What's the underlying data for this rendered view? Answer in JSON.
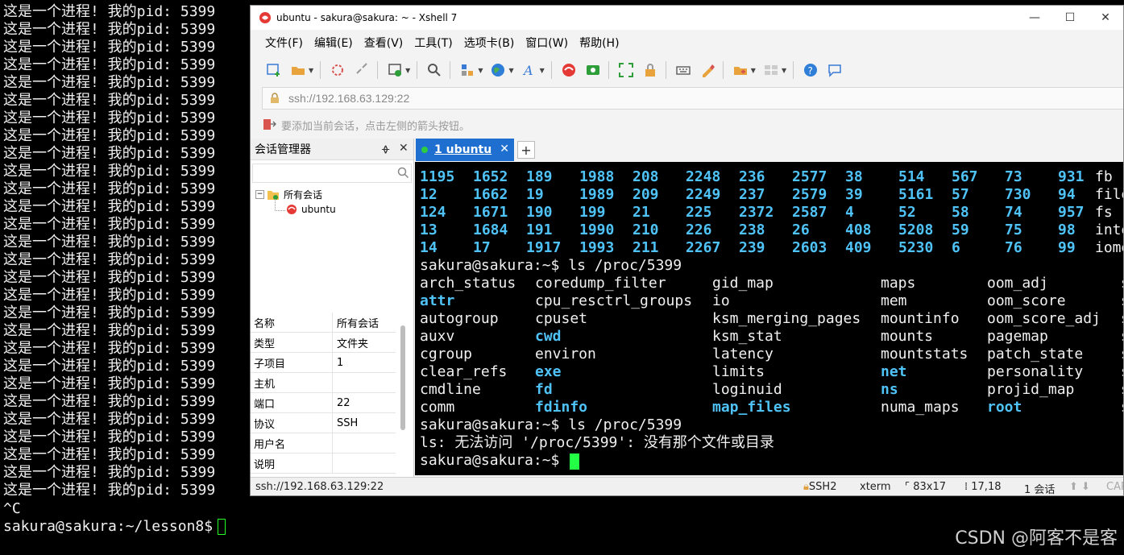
{
  "background_terminal": {
    "repeated_line": "这是一个进程! 我的pid: 5399",
    "line_count": 28,
    "ctrl_c": "^C",
    "prompt": "sakura@sakura:~/lesson8$"
  },
  "watermark": "CSDN @阿客不是客",
  "window": {
    "title": "ubuntu - sakura@sakura: ~ - Xshell 7",
    "controls": {
      "minimize": "—",
      "maximize": "☐",
      "close": "✕"
    }
  },
  "menu": [
    "文件(F)",
    "编辑(E)",
    "查看(V)",
    "工具(T)",
    "选项卡(B)",
    "窗口(W)",
    "帮助(H)"
  ],
  "address": {
    "value": "ssh://192.168.63.129:22"
  },
  "hint": "要添加当前会话，点击左侧的箭头按钮。",
  "session_manager": {
    "title": "会话管理器",
    "pin": "ᚖ",
    "close": "✕",
    "tree": {
      "root": "所有会话",
      "child": "ubuntu"
    },
    "properties": [
      {
        "key": "名称",
        "value": "所有会话"
      },
      {
        "key": "类型",
        "value": "文件夹"
      },
      {
        "key": "子项目",
        "value": "1"
      },
      {
        "key": "主机",
        "value": ""
      },
      {
        "key": "端口",
        "value": "22"
      },
      {
        "key": "协议",
        "value": "SSH"
      },
      {
        "key": "用户名",
        "value": ""
      },
      {
        "key": "说明",
        "value": ""
      }
    ]
  },
  "tabs": [
    {
      "label": "1 ubuntu",
      "close": "✕"
    }
  ],
  "tab_add": "+",
  "terminal": {
    "num_rows": [
      [
        "1195",
        "1652",
        "189",
        "1988",
        "208",
        "2248",
        "236",
        "2577",
        "38",
        "514",
        "567",
        "73",
        "931",
        "fb"
      ],
      [
        "12",
        "1662",
        "19",
        "1989",
        "209",
        "2249",
        "237",
        "2579",
        "39",
        "5161",
        "57",
        "730",
        "94",
        "file"
      ],
      [
        "124",
        "1671",
        "190",
        "199",
        "21",
        "225",
        "2372",
        "2587",
        "4",
        "52",
        "58",
        "74",
        "957",
        "fs"
      ],
      [
        "13",
        "1684",
        "191",
        "1990",
        "210",
        "226",
        "238",
        "26",
        "408",
        "5208",
        "59",
        "75",
        "98",
        "inte"
      ],
      [
        "14",
        "17",
        "1917",
        "1993",
        "211",
        "2267",
        "239",
        "2603",
        "409",
        "5230",
        "6",
        "76",
        "99",
        "iome"
      ]
    ],
    "cmd1": "sakura@sakura:~$ ls /proc/5399",
    "proc_rows": [
      [
        {
          "t": "arch_status",
          "d": false
        },
        {
          "t": "coredump_filter",
          "d": false
        },
        {
          "t": "gid_map",
          "d": false
        },
        {
          "t": "maps",
          "d": false
        },
        {
          "t": "oom_adj",
          "d": false
        },
        {
          "t": "s",
          "d": false
        }
      ],
      [
        {
          "t": "attr",
          "d": true
        },
        {
          "t": "cpu_resctrl_groups",
          "d": false
        },
        {
          "t": "io",
          "d": false
        },
        {
          "t": "mem",
          "d": false
        },
        {
          "t": "oom_score",
          "d": false
        },
        {
          "t": "s",
          "d": false
        }
      ],
      [
        {
          "t": "autogroup",
          "d": false
        },
        {
          "t": "cpuset",
          "d": false
        },
        {
          "t": "ksm_merging_pages",
          "d": false
        },
        {
          "t": "mountinfo",
          "d": false
        },
        {
          "t": "oom_score_adj",
          "d": false
        },
        {
          "t": "s",
          "d": false
        }
      ],
      [
        {
          "t": "auxv",
          "d": false
        },
        {
          "t": "cwd",
          "d": true
        },
        {
          "t": "ksm_stat",
          "d": false
        },
        {
          "t": "mounts",
          "d": false
        },
        {
          "t": "pagemap",
          "d": false
        },
        {
          "t": "s",
          "d": false
        }
      ],
      [
        {
          "t": "cgroup",
          "d": false
        },
        {
          "t": "environ",
          "d": false
        },
        {
          "t": "latency",
          "d": false
        },
        {
          "t": "mountstats",
          "d": false
        },
        {
          "t": "patch_state",
          "d": false
        },
        {
          "t": "s",
          "d": false
        }
      ],
      [
        {
          "t": "clear_refs",
          "d": false
        },
        {
          "t": "exe",
          "d": true
        },
        {
          "t": "limits",
          "d": false
        },
        {
          "t": "net",
          "d": true
        },
        {
          "t": "personality",
          "d": false
        },
        {
          "t": "s",
          "d": false
        }
      ],
      [
        {
          "t": "cmdline",
          "d": false
        },
        {
          "t": "fd",
          "d": true
        },
        {
          "t": "loginuid",
          "d": false
        },
        {
          "t": "ns",
          "d": true
        },
        {
          "t": "projid_map",
          "d": false
        },
        {
          "t": "s",
          "d": false
        }
      ],
      [
        {
          "t": "comm",
          "d": false
        },
        {
          "t": "fdinfo",
          "d": true
        },
        {
          "t": "map_files",
          "d": true
        },
        {
          "t": "numa_maps",
          "d": false
        },
        {
          "t": "root",
          "d": true
        },
        {
          "t": "s",
          "d": false
        }
      ]
    ],
    "cmd2": "sakura@sakura:~$ ls /proc/5399",
    "error": "ls: 无法访问 '/proc/5399': 没有那个文件或目录",
    "prompt": "sakura@sakura:~$"
  },
  "statusbar": {
    "address": "ssh://192.168.63.129:22",
    "protocol": "SSH2",
    "terminal_type": "xterm",
    "size": "83x17",
    "cursor_pos": "17,18",
    "sessions": "1 会话",
    "caps": "CAP"
  },
  "colors": {
    "accent": "#1f6fd1",
    "dir": "#4fc3f7",
    "cursor": "#22ff44"
  }
}
